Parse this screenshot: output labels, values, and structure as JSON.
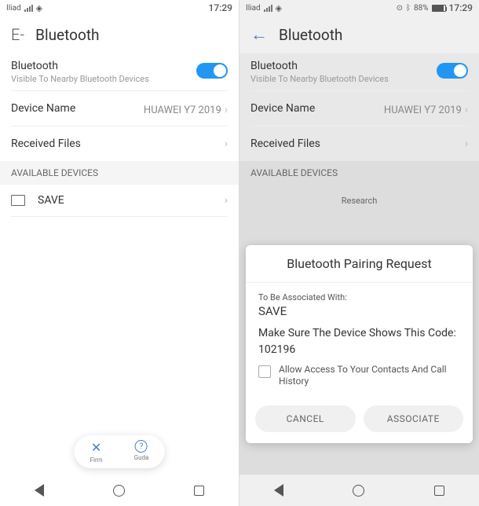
{
  "left": {
    "status": {
      "carrier": "Iliad",
      "time": "17:29"
    },
    "header": {
      "prefix": "E-",
      "title": "Bluetooth"
    },
    "bt": {
      "label": "Bluetooth",
      "sub": "Visible To Nearby Bluetooth Devices"
    },
    "device_name": {
      "label": "Device Name",
      "value": "HUAWEI Y7 2019"
    },
    "received": {
      "label": "Received Files"
    },
    "avail_header": "AVAILABLE DEVICES",
    "device": {
      "name": "SAVE"
    },
    "pill": {
      "firm": "Firm",
      "guda": "Guda"
    }
  },
  "right": {
    "status": {
      "carrier": "Iliad",
      "battery_pct": "88%",
      "time": "17:29"
    },
    "header": {
      "title": "Bluetooth"
    },
    "bt": {
      "label": "Bluetooth",
      "sub": "Visible To Nearby Bluetooth Devices"
    },
    "device_name": {
      "label": "Device Name",
      "value": "HUAWEI Y7 2019"
    },
    "received": {
      "label": "Received Files"
    },
    "avail_header": "AVAILABLE DEVICES",
    "research": "Research",
    "dialog": {
      "title": "Bluetooth Pairing Request",
      "assoc_label": "To Be Associated With:",
      "assoc_value": "SAVE",
      "msg": "Make Sure The Device Shows This Code:",
      "code": "102196",
      "checkbox_label": "Allow Access To Your Contacts And Call History",
      "cancel": "CANCEL",
      "associate": "ASSOCIATE"
    }
  }
}
